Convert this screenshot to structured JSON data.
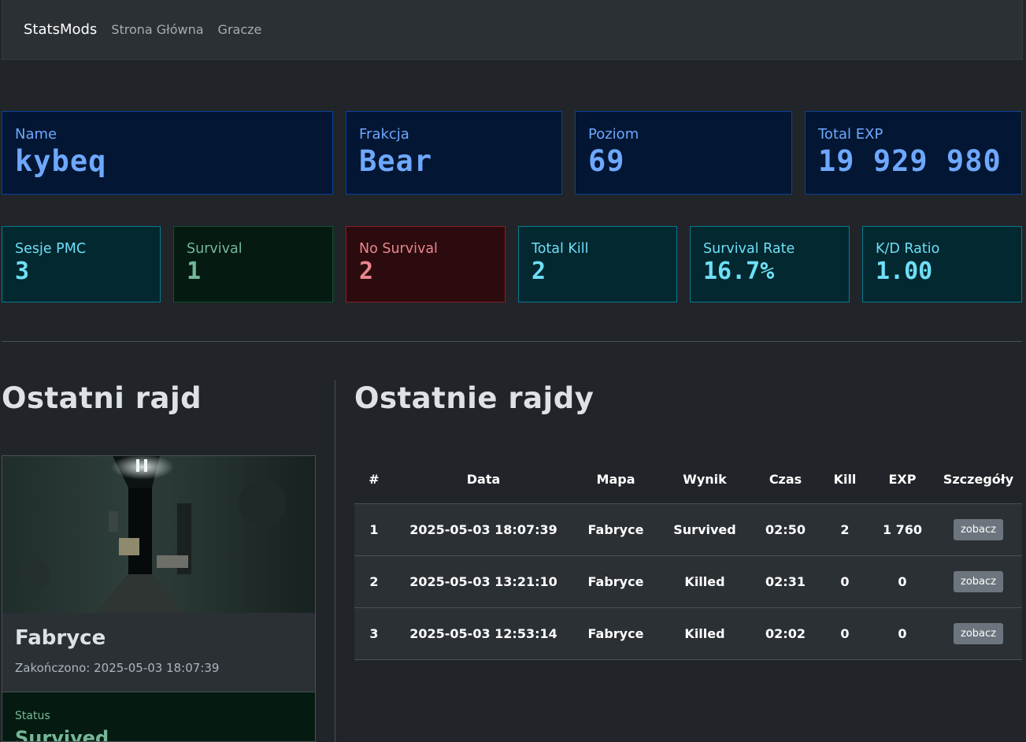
{
  "navbar": {
    "brand": "StatsMods",
    "links": [
      "Strona Główna",
      "Gracze"
    ]
  },
  "profile": {
    "name": {
      "label": "Name",
      "value": "kybeq"
    },
    "faction": {
      "label": "Frakcja",
      "value": "Bear"
    },
    "level": {
      "label": "Poziom",
      "value": "69"
    },
    "total_exp": {
      "label": "Total EXP",
      "value": "19 929 980"
    }
  },
  "stats": {
    "sessions": {
      "label": "Sesje PMC",
      "value": "3"
    },
    "survival": {
      "label": "Survival",
      "value": "1"
    },
    "no_survival": {
      "label": "No Survival",
      "value": "2"
    },
    "total_kill": {
      "label": "Total Kill",
      "value": "2"
    },
    "survival_rate": {
      "label": "Survival Rate",
      "value": "16.7%"
    },
    "kd_ratio": {
      "label": "K/D Ratio",
      "value": "1.00"
    }
  },
  "last_raid": {
    "title": "Ostatni rajd",
    "map": "Fabryce",
    "ended": "Zakończono: 2025-05-03 18:07:39",
    "status_label": "Status",
    "status_value": "Survived"
  },
  "recent_raids": {
    "title": "Ostatnie rajdy",
    "headers": [
      "#",
      "Data",
      "Mapa",
      "Wynik",
      "Czas",
      "Kill",
      "EXP",
      "Szczegóły"
    ],
    "rows": [
      {
        "num": "1",
        "date": "2025-05-03 18:07:39",
        "map": "Fabryce",
        "result": "Survived",
        "time": "02:50",
        "kill": "2",
        "exp": "1 760",
        "action": "zobacz"
      },
      {
        "num": "2",
        "date": "2025-05-03 13:21:10",
        "map": "Fabryce",
        "result": "Killed",
        "time": "02:31",
        "kill": "0",
        "exp": "0",
        "action": "zobacz"
      },
      {
        "num": "3",
        "date": "2025-05-03 12:53:14",
        "map": "Fabryce",
        "result": "Killed",
        "time": "02:02",
        "kill": "0",
        "exp": "0",
        "action": "zobacz"
      }
    ]
  }
}
